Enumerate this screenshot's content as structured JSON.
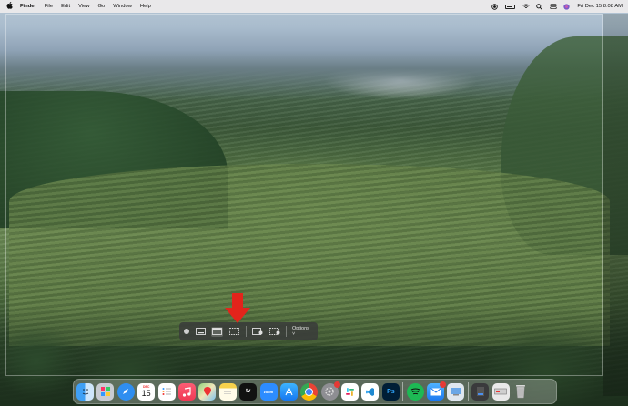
{
  "menubar": {
    "app_name": "Finder",
    "menus": [
      "File",
      "Edit",
      "View",
      "Go",
      "Window",
      "Help"
    ],
    "clock": "Fri Dec 15  8:08 AM"
  },
  "screenshot_toolbar": {
    "options_label": "Options ˅",
    "tools": [
      "close",
      "capture-entire-screen",
      "capture-selected-window",
      "capture-selected-portion",
      "record-entire-screen",
      "record-selected-portion"
    ],
    "selected_tool": "capture-selected-portion"
  },
  "dock": {
    "calendar": {
      "month": "DEC",
      "day": "15"
    },
    "tv_label": "tv",
    "zoom_label": "zoom",
    "photoshop_label": "Ps",
    "apps": [
      "finder",
      "launchpad",
      "safari",
      "calendar",
      "reminders",
      "music",
      "maps",
      "notes",
      "apple-tv",
      "zoom",
      "app-store",
      "chrome",
      "system-settings",
      "slack",
      "vscode",
      "photoshop",
      "spotify",
      "mail",
      "preview",
      "downloads",
      "scanner",
      "trash"
    ]
  },
  "colors": {
    "arrow": "#e3241b",
    "menubar": "#e9e8ea"
  }
}
